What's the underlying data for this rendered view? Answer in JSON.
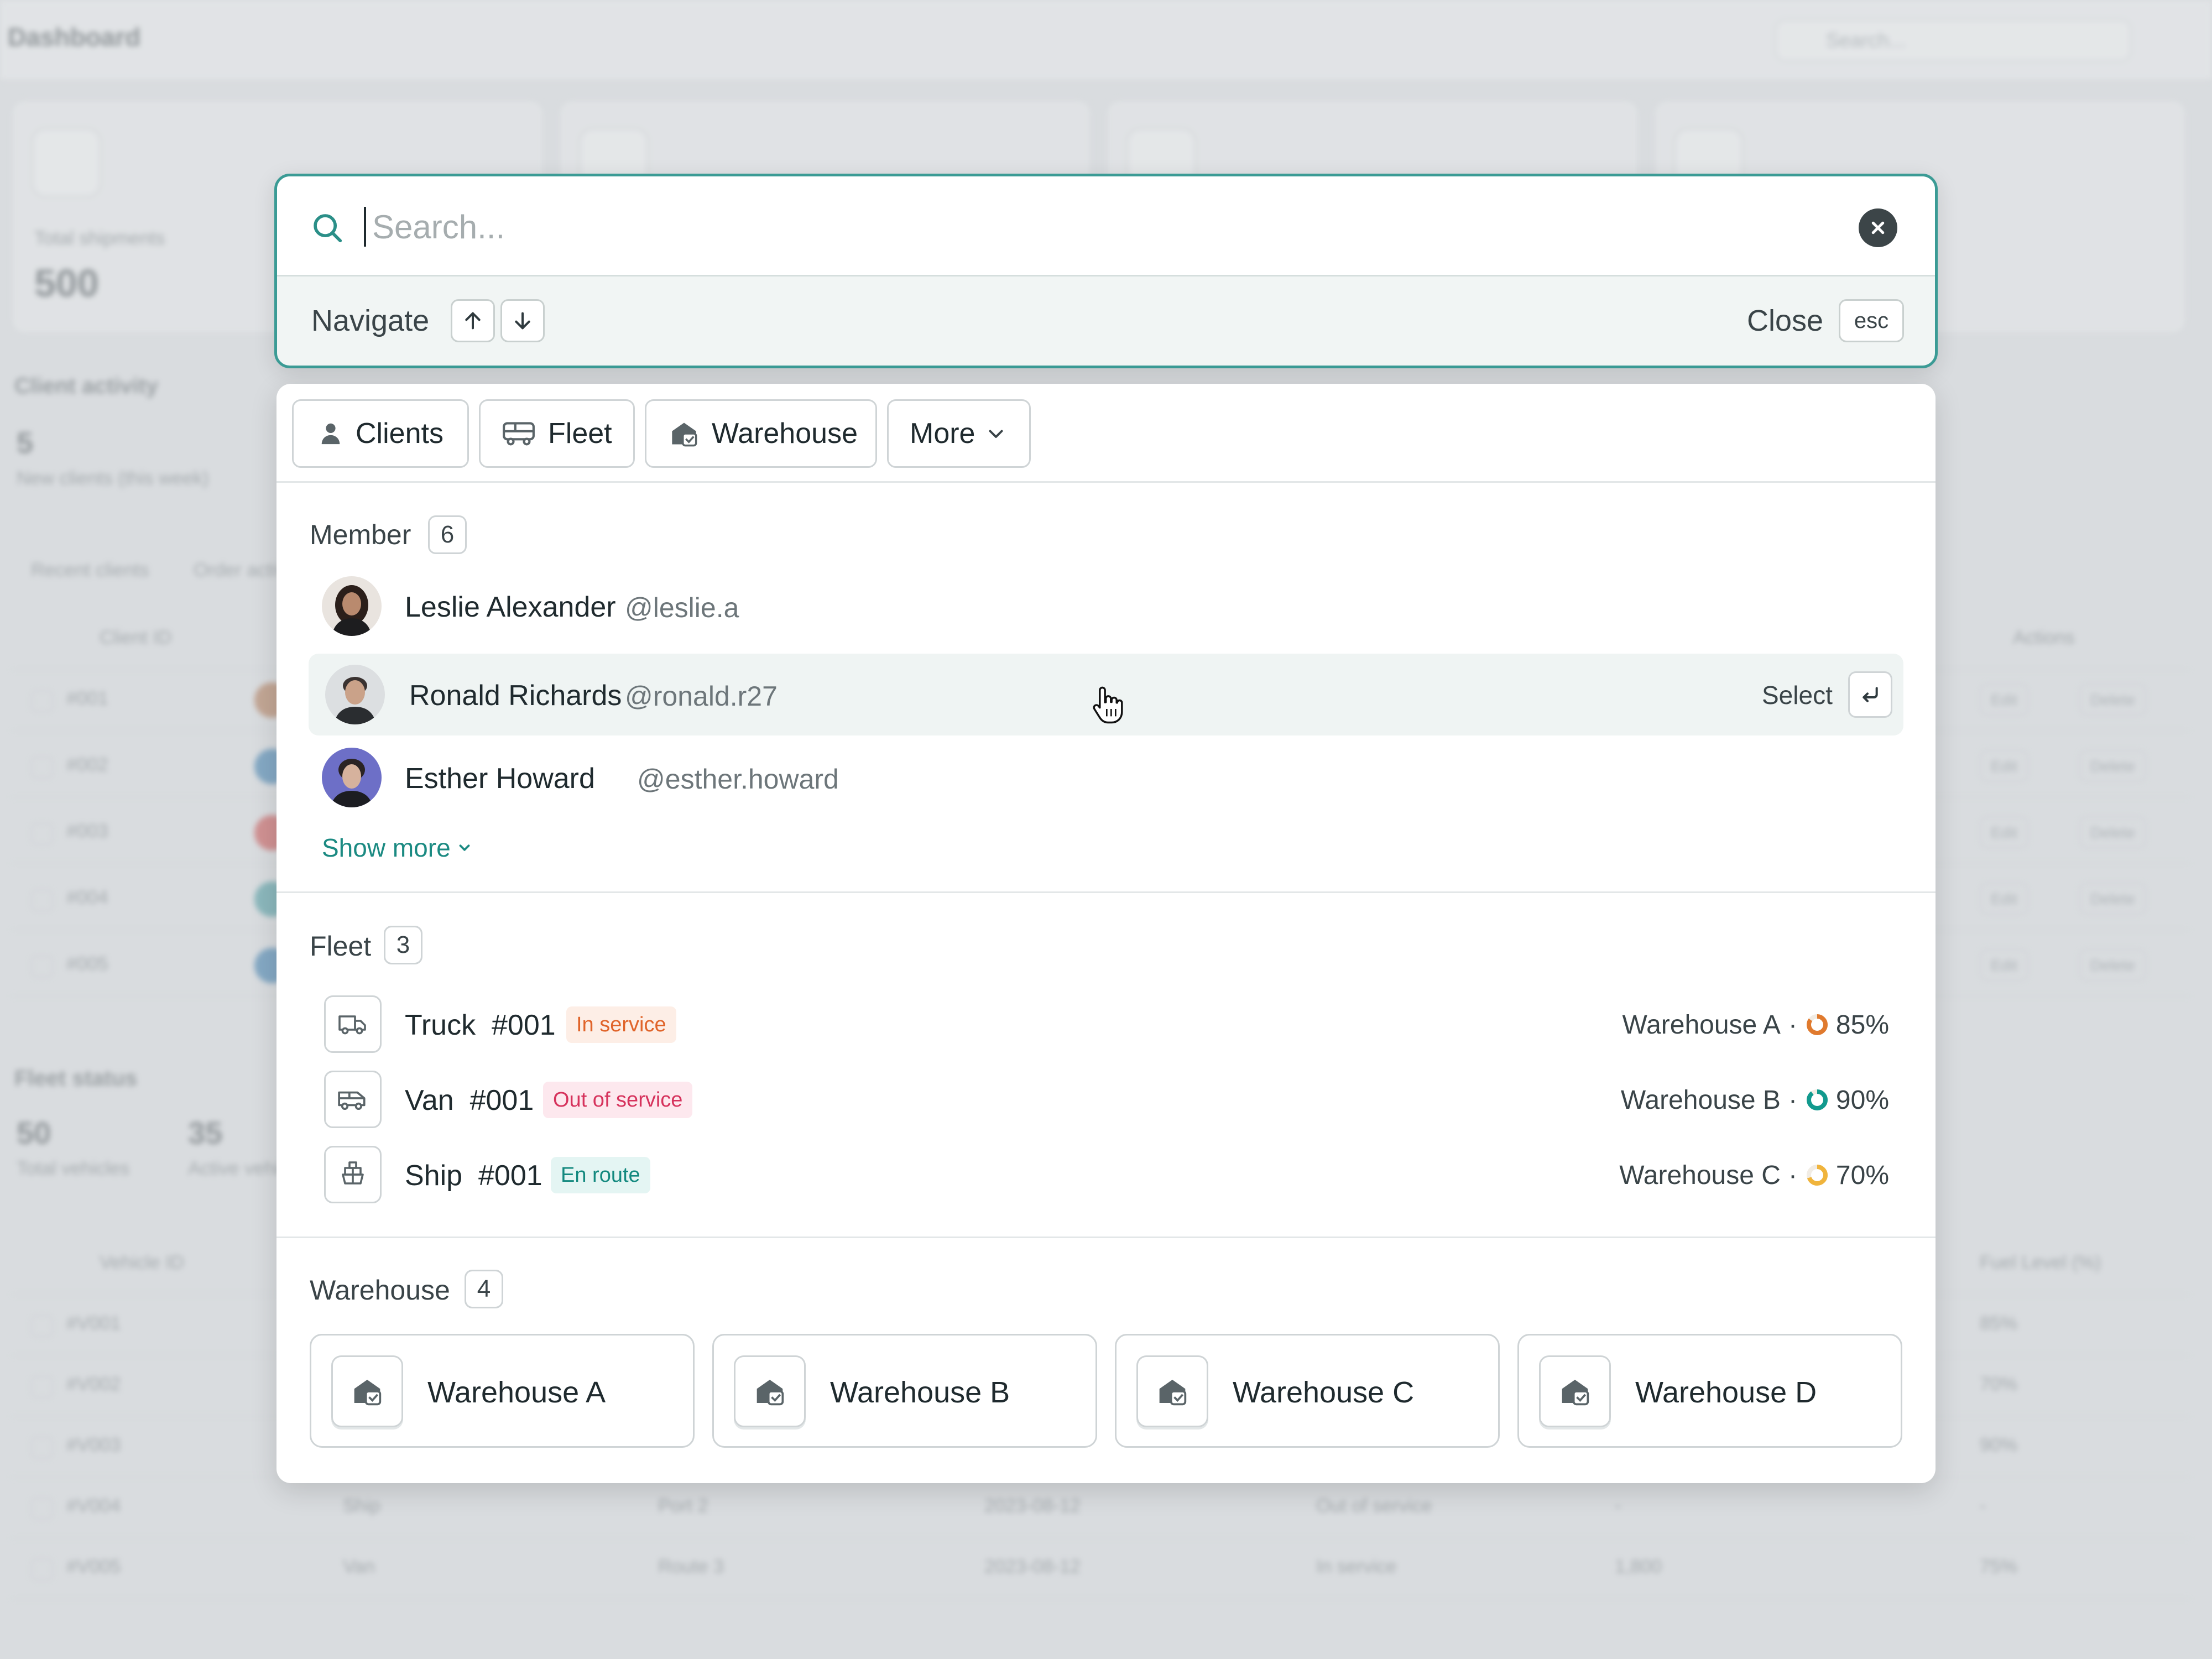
{
  "background": {
    "title": "Dashboard",
    "search_placeholder": "Search...",
    "stat_label": "Total shipments",
    "stat_value": "500",
    "client_activity_title": "Client activity",
    "new_clients_count": "5",
    "new_clients_label": "New clients (this week)",
    "tabs": [
      "Recent clients",
      "Order activity"
    ],
    "client_header_id": "Client ID",
    "client_header_actions": "Actions",
    "client_ids": [
      "#001",
      "#002",
      "#003",
      "#004",
      "#005"
    ],
    "action_edit": "Edit",
    "action_delete": "Delete",
    "fleet_status_title": "Fleet status",
    "total_vehicles_value": "50",
    "total_vehicles_label": "Total vehicles",
    "active_vehicles_value": "35",
    "active_vehicles_label": "Active vehicles",
    "vehicle_header_id": "Vehicle ID",
    "vehicle_header_fuel": "Fuel Level (%)",
    "vehicle_ids": [
      "#V001",
      "#V002",
      "#V003",
      "#V004",
      "#V005"
    ],
    "vehicle_fuel": [
      "85%",
      "70%",
      "90%",
      "-",
      "75%"
    ],
    "row4": {
      "type": "Ship",
      "route": "Port 2",
      "date": "2023-08-12",
      "status": "Out of service",
      "distance": "-"
    },
    "row5": {
      "type": "Van",
      "route": "Route 3",
      "date": "2023-08-12",
      "status": "In service",
      "distance": "1,800"
    }
  },
  "search": {
    "placeholder": "Search...",
    "navigate_label": "Navigate",
    "close_label": "Close",
    "esc_key": "esc"
  },
  "filters": {
    "clients": "Clients",
    "fleet": "Fleet",
    "warehouse": "Warehouse",
    "more": "More"
  },
  "members": {
    "title": "Member",
    "count": "6",
    "items": [
      {
        "name": "Leslie Alexander",
        "handle": "@leslie.a"
      },
      {
        "name": "Ronald Richards",
        "handle": "@ronald.r27"
      },
      {
        "name": "Esther Howard",
        "handle": "@esther.howard"
      }
    ],
    "select_label": "Select",
    "show_more": "Show more"
  },
  "fleet": {
    "title": "Fleet",
    "count": "3",
    "items": [
      {
        "type": "Truck",
        "id": "#001",
        "status": "In service",
        "warehouse": "Warehouse A",
        "level": "85%",
        "level_value": 85,
        "status_color": "#e0642a",
        "status_bg": "#fdeee6",
        "gauge_color": "#e07a2e"
      },
      {
        "type": "Van",
        "id": "#001",
        "status": "Out of service",
        "warehouse": "Warehouse B",
        "level": "90%",
        "level_value": 90,
        "status_color": "#d6325c",
        "status_bg": "#fde8ee",
        "gauge_color": "#129a8e"
      },
      {
        "type": "Ship",
        "id": "#001",
        "status": "En route",
        "warehouse": "Warehouse C",
        "level": "70%",
        "level_value": 70,
        "status_color": "#13897f",
        "status_bg": "#e4f5f3",
        "gauge_color": "#f0b43c"
      }
    ]
  },
  "warehouse": {
    "title": "Warehouse",
    "count": "4",
    "items": [
      "Warehouse A",
      "Warehouse B",
      "Warehouse C",
      "Warehouse D"
    ]
  },
  "colors": {
    "accent": "#3b9b95",
    "link": "#1b8a82"
  }
}
